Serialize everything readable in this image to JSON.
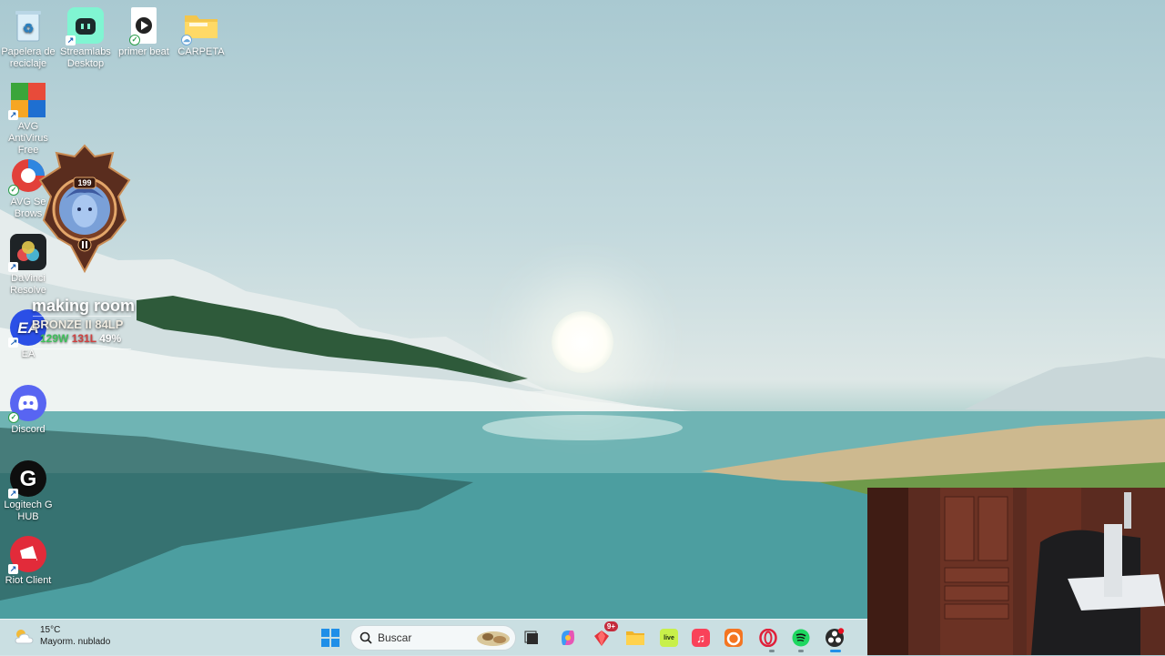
{
  "desktop": {
    "icons": [
      {
        "label": "Papelera de reciclaje",
        "icon": "recycle-bin-icon"
      },
      {
        "label": "Streamlabs Desktop",
        "icon": "streamlabs-icon"
      },
      {
        "label": "primer beat",
        "icon": "video-file-icon"
      },
      {
        "label": "CARPETA",
        "icon": "folder-icon"
      },
      {
        "label": "AVG AntiVirus Free",
        "icon": "avg-antivirus-icon"
      },
      {
        "label": "AVG Se Brows",
        "icon": "avg-browser-icon"
      },
      {
        "label": "DaVinci Resolve",
        "icon": "davinci-resolve-icon"
      },
      {
        "label": "EA",
        "icon": "ea-icon"
      },
      {
        "label": "Discord",
        "icon": "discord-icon"
      },
      {
        "label": "Logitech G HUB",
        "icon": "logitech-g-hub-icon"
      },
      {
        "label": "Riot Client",
        "icon": "riot-client-icon"
      }
    ]
  },
  "lol_overlay": {
    "level": "199",
    "summoner": "making room",
    "rank": "BRONZE II 84LP",
    "wins": "129W",
    "losses": "131L",
    "winrate": "49%"
  },
  "taskbar": {
    "weather": {
      "temp": "15°C",
      "condition": "Mayorm. nublado",
      "icon": "partly-cloudy-icon"
    },
    "search_placeholder": "Buscar",
    "apps": [
      {
        "name": "start-button",
        "icon": "windows-logo-icon"
      },
      {
        "name": "task-view",
        "icon": "task-view-icon"
      },
      {
        "name": "copilot",
        "icon": "copilot-icon"
      },
      {
        "name": "app-badge",
        "icon": "gem-icon",
        "badge": "9+"
      },
      {
        "name": "file-explorer",
        "icon": "folder-icon"
      },
      {
        "name": "livestream",
        "icon": "live-icon"
      },
      {
        "name": "apple-music",
        "icon": "music-icon"
      },
      {
        "name": "crunchyroll",
        "icon": "crunchyroll-icon"
      },
      {
        "name": "opera",
        "icon": "opera-icon"
      },
      {
        "name": "spotify",
        "icon": "spotify-icon"
      },
      {
        "name": "obs",
        "icon": "obs-icon"
      }
    ]
  },
  "colors": {
    "taskbar_bg": "#d6e6ea",
    "lol_win": "#3fbf5a",
    "lol_loss": "#d04040"
  }
}
